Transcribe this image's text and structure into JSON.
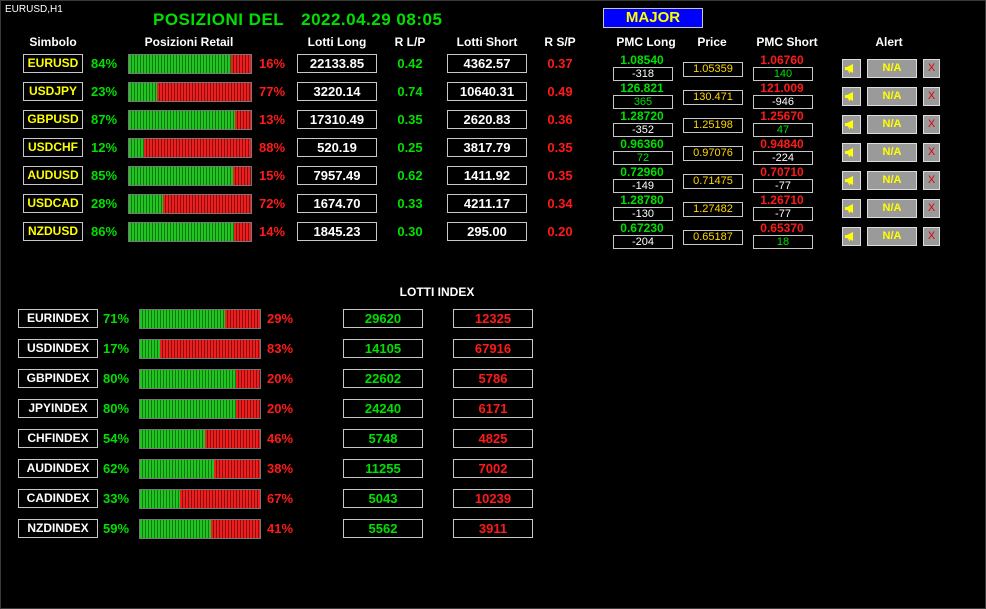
{
  "chart_label": "EURUSD,H1",
  "title": {
    "prefix": "POSIZIONI  DEL",
    "datetime": "2022.04.29 08:05"
  },
  "major_button": "MAJOR",
  "headers": {
    "simbolo": "Simbolo",
    "posizioni_retail": "Posizioni Retail",
    "lotti_long": "Lotti Long",
    "r_lp": "R L/P",
    "lotti_short": "Lotti Short",
    "r_sp": "R S/P",
    "pmc_long": "PMC Long",
    "price": "Price",
    "pmc_short": "PMC Short",
    "alert": "Alert"
  },
  "pairs": [
    {
      "symbol": "EURUSD",
      "long_pct": "84%",
      "short_pct": "16%",
      "long_frac": 0.84,
      "lotti_long": "22133.85",
      "r_lp": "0.42",
      "lotti_short": "4362.57",
      "r_sp": "0.37",
      "pmc_long": "1.08540",
      "pmc_long_diff": "-318",
      "price": "1.05359",
      "pmc_short": "1.06760",
      "pmc_short_diff": "140",
      "pmc_long_diff_color": "#ffffff",
      "pmc_short_diff_color": "#00e000",
      "alert": "N/A",
      "x": "X"
    },
    {
      "symbol": "USDJPY",
      "long_pct": "23%",
      "short_pct": "77%",
      "long_frac": 0.23,
      "lotti_long": "3220.14",
      "r_lp": "0.74",
      "lotti_short": "10640.31",
      "r_sp": "0.49",
      "pmc_long": "126.821",
      "pmc_long_diff": "365",
      "price": "130.471",
      "pmc_short": "121.009",
      "pmc_short_diff": "-946",
      "pmc_long_diff_color": "#00e000",
      "pmc_short_diff_color": "#ffffff",
      "alert": "N/A",
      "x": "X"
    },
    {
      "symbol": "GBPUSD",
      "long_pct": "87%",
      "short_pct": "13%",
      "long_frac": 0.87,
      "lotti_long": "17310.49",
      "r_lp": "0.35",
      "lotti_short": "2620.83",
      "r_sp": "0.36",
      "pmc_long": "1.28720",
      "pmc_long_diff": "-352",
      "price": "1.25198",
      "pmc_short": "1.25670",
      "pmc_short_diff": "47",
      "pmc_long_diff_color": "#ffffff",
      "pmc_short_diff_color": "#00e000",
      "alert": "N/A",
      "x": "X"
    },
    {
      "symbol": "USDCHF",
      "long_pct": "12%",
      "short_pct": "88%",
      "long_frac": 0.12,
      "lotti_long": "520.19",
      "r_lp": "0.25",
      "lotti_short": "3817.79",
      "r_sp": "0.35",
      "pmc_long": "0.96360",
      "pmc_long_diff": "72",
      "price": "0.97076",
      "pmc_short": "0.94840",
      "pmc_short_diff": "-224",
      "pmc_long_diff_color": "#00e000",
      "pmc_short_diff_color": "#ffffff",
      "alert": "N/A",
      "x": "X"
    },
    {
      "symbol": "AUDUSD",
      "long_pct": "85%",
      "short_pct": "15%",
      "long_frac": 0.85,
      "lotti_long": "7957.49",
      "r_lp": "0.62",
      "lotti_short": "1411.92",
      "r_sp": "0.35",
      "pmc_long": "0.72960",
      "pmc_long_diff": "-149",
      "price": "0.71475",
      "pmc_short": "0.70710",
      "pmc_short_diff": "-77",
      "pmc_long_diff_color": "#ffffff",
      "pmc_short_diff_color": "#ffffff",
      "alert": "N/A",
      "x": "X"
    },
    {
      "symbol": "USDCAD",
      "long_pct": "28%",
      "short_pct": "72%",
      "long_frac": 0.28,
      "lotti_long": "1674.70",
      "r_lp": "0.33",
      "lotti_short": "4211.17",
      "r_sp": "0.34",
      "pmc_long": "1.28780",
      "pmc_long_diff": "-130",
      "price": "1.27482",
      "pmc_short": "1.26710",
      "pmc_short_diff": "-77",
      "pmc_long_diff_color": "#ffffff",
      "pmc_short_diff_color": "#ffffff",
      "alert": "N/A",
      "x": "X"
    },
    {
      "symbol": "NZDUSD",
      "long_pct": "86%",
      "short_pct": "14%",
      "long_frac": 0.86,
      "lotti_long": "1845.23",
      "r_lp": "0.30",
      "lotti_short": "295.00",
      "r_sp": "0.20",
      "pmc_long": "0.67230",
      "pmc_long_diff": "-204",
      "price": "0.65187",
      "pmc_short": "0.65370",
      "pmc_short_diff": "18",
      "pmc_long_diff_color": "#ffffff",
      "pmc_short_diff_color": "#00e000",
      "alert": "N/A",
      "x": "X"
    }
  ],
  "lotti_index_title": "LOTTI INDEX",
  "indices": [
    {
      "name": "EURINDEX",
      "long_pct": "71%",
      "short_pct": "29%",
      "long_frac": 0.71,
      "long": "29620",
      "short": "12325"
    },
    {
      "name": "USDINDEX",
      "long_pct": "17%",
      "short_pct": "83%",
      "long_frac": 0.17,
      "long": "14105",
      "short": "67916"
    },
    {
      "name": "GBPINDEX",
      "long_pct": "80%",
      "short_pct": "20%",
      "long_frac": 0.8,
      "long": "22602",
      "short": "5786"
    },
    {
      "name": "JPYINDEX",
      "long_pct": "80%",
      "short_pct": "20%",
      "long_frac": 0.8,
      "long": "24240",
      "short": "6171"
    },
    {
      "name": "CHFINDEX",
      "long_pct": "54%",
      "short_pct": "46%",
      "long_frac": 0.54,
      "long": "5748",
      "short": "4825"
    },
    {
      "name": "AUDINDEX",
      "long_pct": "62%",
      "short_pct": "38%",
      "long_frac": 0.62,
      "long": "11255",
      "short": "7002"
    },
    {
      "name": "CADINDEX",
      "long_pct": "33%",
      "short_pct": "67%",
      "long_frac": 0.33,
      "long": "5043",
      "short": "10239"
    },
    {
      "name": "NZDINDEX",
      "long_pct": "59%",
      "short_pct": "41%",
      "long_frac": 0.59,
      "long": "5562",
      "short": "3911"
    }
  ],
  "colors": {
    "green": "#00e000",
    "red": "#ff1a1a",
    "yellow": "#ffff00",
    "price": "#ffd700",
    "major_bg": "#0000ff"
  },
  "icons": {
    "alert_button": "megaphone-icon",
    "remove_button": "close-icon"
  }
}
